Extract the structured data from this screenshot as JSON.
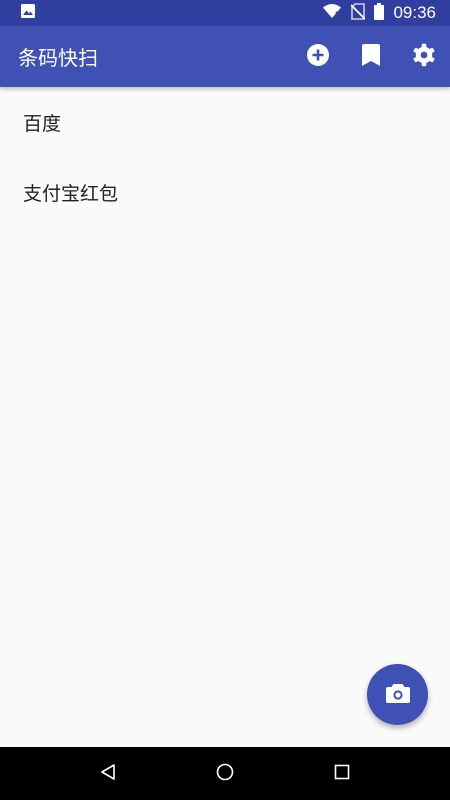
{
  "status_bar": {
    "time": "09:36",
    "icons": [
      "image-icon",
      "wifi-icon",
      "no-sim-icon",
      "battery-icon"
    ]
  },
  "app_bar": {
    "title": "条码快扫",
    "actions": [
      "add-circle-icon",
      "bookmark-icon",
      "gear-icon"
    ]
  },
  "list": {
    "items": [
      {
        "label": "百度"
      },
      {
        "label": "支付宝红包"
      }
    ]
  },
  "fab": {
    "icon": "camera-icon"
  },
  "nav_bar": {
    "buttons": [
      "back-icon",
      "home-icon",
      "recents-icon"
    ]
  },
  "colors": {
    "primary": "#3f51b5",
    "primary_dark": "#303f9f",
    "background": "#fafafa",
    "text": "#212121"
  }
}
